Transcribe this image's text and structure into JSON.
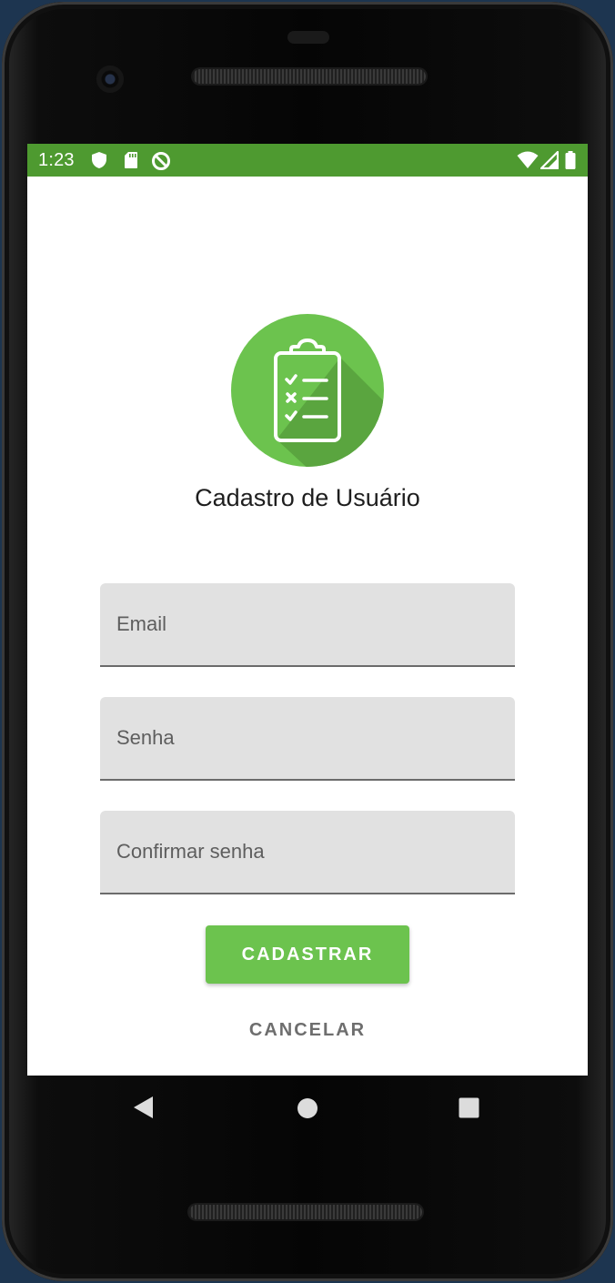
{
  "status_bar": {
    "time": "1:23",
    "background_color": "#4e9a30",
    "left_icons": [
      "shield-icon",
      "sd-card-icon",
      "sync-disabled-icon"
    ],
    "right_icons": [
      "wifi-icon",
      "cell-signal-icon",
      "battery-icon"
    ]
  },
  "app": {
    "logo_icon": "clipboard-checklist-icon",
    "title": "Cadastro de Usuário",
    "accent_color": "#6cc34e"
  },
  "form": {
    "email_placeholder": "Email",
    "password_placeholder": "Senha",
    "confirm_password_placeholder": "Confirmar senha",
    "email_value": "",
    "password_value": "",
    "confirm_password_value": ""
  },
  "actions": {
    "register_label": "CADASTRAR",
    "cancel_label": "CANCELAR"
  },
  "navigation_bar": {
    "buttons": [
      "back-icon",
      "home-icon",
      "recents-icon"
    ]
  }
}
